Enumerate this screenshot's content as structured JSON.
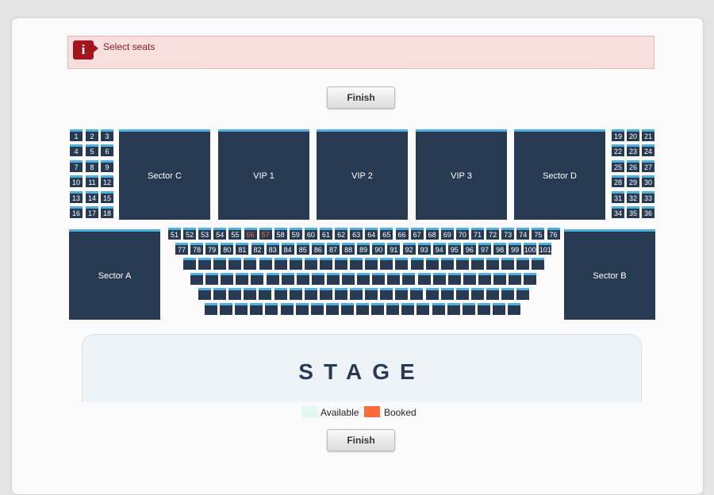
{
  "alert": {
    "icon": "info-icon",
    "icon_glyph": "i",
    "message": "Select seats"
  },
  "buttons": {
    "finish_top": "Finish",
    "finish_bottom": "Finish"
  },
  "colors": {
    "seat": "#273a52",
    "seat_top": "#4fb0e0",
    "available": "#e1f7ef",
    "booked": "#ff6a3c",
    "alert_bg": "#f7dada"
  },
  "left_seat_rows": [
    [
      "1",
      "2",
      "3"
    ],
    [
      "4",
      "5",
      "6"
    ],
    [
      "7",
      "8",
      "9"
    ],
    [
      "10",
      "11",
      "12"
    ],
    [
      "13",
      "14",
      "15"
    ],
    [
      "16",
      "17",
      "18"
    ]
  ],
  "right_seat_rows": [
    [
      "19",
      "20",
      "21"
    ],
    [
      "22",
      "23",
      "24"
    ],
    [
      "25",
      "26",
      "27"
    ],
    [
      "28",
      "29",
      "30"
    ],
    [
      "31",
      "32",
      "33"
    ],
    [
      "34",
      "35",
      "36"
    ]
  ],
  "blocks": [
    "Sector C",
    "VIP 1",
    "VIP 2",
    "VIP 3",
    "Sector D",
    "Sector A",
    "Sector B"
  ],
  "center_row1": [
    "51",
    "52",
    "53",
    "54",
    "55",
    "56",
    "57",
    "58",
    "59",
    "60",
    "61",
    "62",
    "63",
    "64",
    "65",
    "66",
    "67",
    "68",
    "69",
    "70",
    "71",
    "72",
    "73",
    "74",
    "75",
    "76"
  ],
  "center_row2": [
    "77",
    "78",
    "79",
    "80",
    "81",
    "82",
    "83",
    "84",
    "85",
    "86",
    "87",
    "88",
    "89",
    "90",
    "91",
    "92",
    "93",
    "94",
    "95",
    "96",
    "97",
    "98",
    "99",
    "100",
    "101"
  ],
  "booked_seats": [
    "56",
    "57"
  ],
  "stage": {
    "label": "STAGE"
  },
  "legend": {
    "available": "Available",
    "booked": "Booked"
  }
}
